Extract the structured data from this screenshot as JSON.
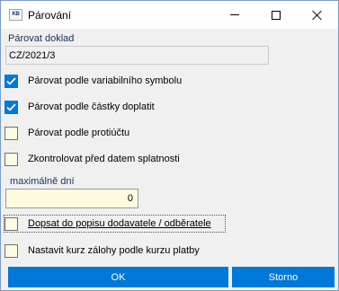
{
  "window": {
    "title": "Párování",
    "icon_text": "KB",
    "controls": {
      "minimize": "minimize-icon",
      "maximize": "maximize-icon",
      "close": "close-icon"
    }
  },
  "document": {
    "label": "Párovat doklad",
    "value": "CZ/2021/3"
  },
  "options": [
    {
      "label": "Párovat podle variabilního symbolu",
      "checked": true
    },
    {
      "label": "Párovat podle částky doplatit",
      "checked": true
    },
    {
      "label": "Párovat podle protiúčtu",
      "checked": false
    },
    {
      "label": "Zkontrolovat před datem splatnosti",
      "checked": false
    }
  ],
  "max_days": {
    "label": "maximálně dní",
    "value": "0"
  },
  "extra_options": [
    {
      "label": "Dopsat do popisu dodavatele / odběratele",
      "checked": false,
      "focused": true
    },
    {
      "label": "Nastavit kurz zálohy podle kurzu platby",
      "checked": false
    }
  ],
  "buttons": {
    "ok": "OK",
    "cancel": "Storno"
  },
  "colors": {
    "accent": "#0078d7",
    "input_bg": "#fffbe0",
    "label_text": "#1a2f5a"
  }
}
